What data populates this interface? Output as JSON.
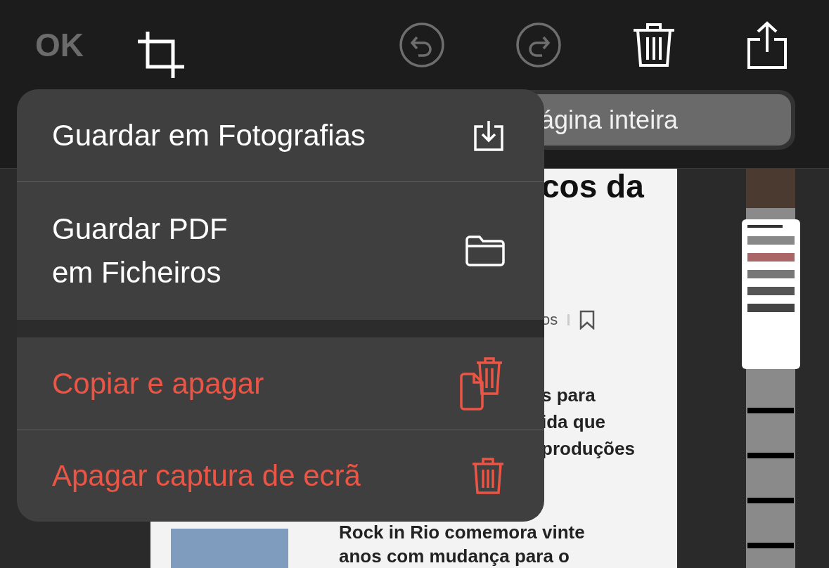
{
  "toolbar": {
    "done": {
      "label": "OK",
      "disabled": true
    },
    "tools": [
      {
        "kind": "crop",
        "disabled": false
      },
      {
        "kind": "undo",
        "disabled": true
      },
      {
        "kind": "redo",
        "disabled": true
      },
      {
        "kind": "trash",
        "disabled": false
      },
      {
        "kind": "share",
        "disabled": false
      }
    ]
  },
  "segments": [
    {
      "label": "ágina inteira",
      "selected": true
    }
  ],
  "preview": {
    "title": "cos da",
    "byline": "os",
    "summary": [
      "s para",
      "ida que",
      "produções"
    ],
    "article": [
      "Rock in Rio comemora vinte",
      "anos com mudança para o"
    ]
  },
  "menu": {
    "sections": [
      [
        {
          "label": "Guardar em Fotografias",
          "kind": "save",
          "destructive": false
        },
        {
          "label": "Guardar PDF\nem Ficheiros",
          "kind": "folder",
          "destructive": false
        }
      ],
      [
        {
          "label": "Copiar e apagar",
          "kind": "copy-trash",
          "destructive": true
        },
        {
          "label": "Apagar captura de ecrã",
          "kind": "trash",
          "destructive": true
        }
      ]
    ]
  }
}
